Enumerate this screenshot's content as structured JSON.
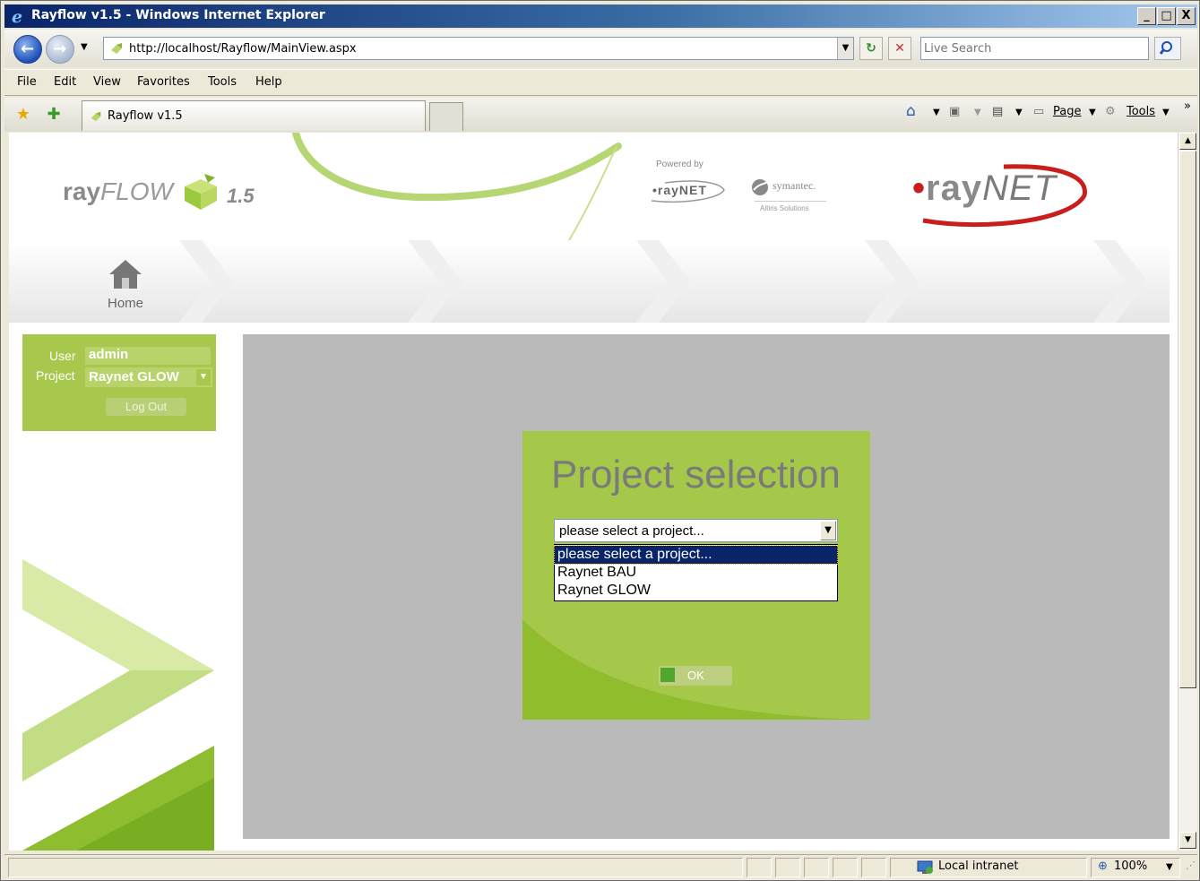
{
  "window": {
    "title": "Rayflow v1.5 - Windows Internet Explorer",
    "caption_buttons": [
      "_",
      "□",
      "X"
    ]
  },
  "address_bar": {
    "url": "http://localhost/Rayflow/MainView.aspx",
    "search_placeholder": "Live Search"
  },
  "menu": {
    "items": [
      "File",
      "Edit",
      "View",
      "Favorites",
      "Tools",
      "Help"
    ]
  },
  "tabbar": {
    "tab_label": "Rayflow v1.5",
    "tools": {
      "page": "Page",
      "tools": "Tools",
      "overflow": "»"
    }
  },
  "header": {
    "logo_ray": "ray",
    "logo_flow": "FLOW",
    "version": "1.5",
    "powered_by": "Powered by",
    "raynet_small": "•rayNET",
    "symantec": "symantec.",
    "altiris": "Altiris Solutions",
    "raynet_big_dot": "•",
    "raynet_big_ray": "ray",
    "raynet_big_net": "NET",
    "home_label": "Home"
  },
  "user_panel": {
    "user_label": "User",
    "user_value": "admin",
    "project_label": "Project",
    "project_value": "Raynet GLOW",
    "logout_label": "Log Out"
  },
  "dialog": {
    "title": "Project selection",
    "select_value": "please select a project...",
    "options": [
      "please select a project...",
      "Raynet BAU",
      "Raynet GLOW"
    ],
    "selected_index": 0,
    "ok_label": "OK"
  },
  "statusbar": {
    "zone": "Local intranet",
    "zoom": "100%"
  },
  "colors": {
    "brand_green": "#a6c84a",
    "panel_grey": "#bababa",
    "selection_blue": "#0a246a",
    "raynet_red": "#c81e1e"
  }
}
